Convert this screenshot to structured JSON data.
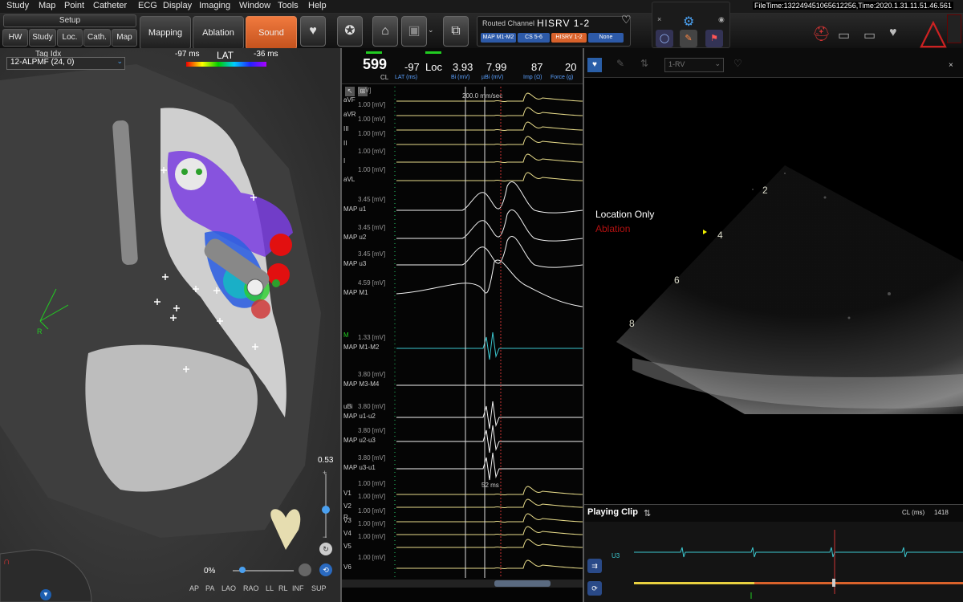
{
  "menu": [
    "Study",
    "Map",
    "Point",
    "Catheter",
    "ECG",
    "Display",
    "Imaging",
    "Window",
    "Tools",
    "Help"
  ],
  "status": {
    "file_time": "FileTime:132249451065612256,Time:2020.1.31.11.51.46.561"
  },
  "toolbar": {
    "setup_label": "Setup",
    "setup_buttons": [
      "HW",
      "Study",
      "Loc.",
      "Cath.",
      "Map"
    ],
    "mapping_label": "Mapping",
    "ablation_label": "Ablation",
    "sound_label": "Sound",
    "routed_channel_label": "Routed Channel",
    "routed_channel_value": "HISRV 1-2",
    "channel_buttons": [
      "MAP M1-M2",
      "CS 5-6",
      "HISRV 1-2",
      "None"
    ]
  },
  "left_panel": {
    "tag_label": "Tag Idx",
    "map_name": "12-ALPMF (24, 0)",
    "lat_min": "-97 ms",
    "lat_title": "LAT",
    "lat_max": "-36 ms",
    "zoom_value": "0.53",
    "pct_label": "0%",
    "axis_label": "R",
    "views": [
      "AP",
      "PA",
      "LAO",
      "RAO",
      "LL",
      "RL",
      "INF",
      "SUP"
    ]
  },
  "signal_panel": {
    "cl_value": "599",
    "cl_label": "CL",
    "lat_value": "-97",
    "lat_label": "LAT (ms)",
    "loc_label": "Loc",
    "bi_value": "3.93",
    "bi_label": "Bi (mV)",
    "ubi_value": "7.99",
    "ubi_label": "µBi (mV)",
    "imp_value": "87",
    "imp_label": "Imp (Ω)",
    "force_value": "20",
    "force_label": "Force (g)",
    "sweep_label": "200.0 mm/sec",
    "interval_label": "52 ms",
    "ubi_tag": "uBi",
    "m_tag": "M",
    "r_tag": "R",
    "traces": [
      {
        "name": "aVF",
        "mv": "[mV]"
      },
      {
        "name": "aVR",
        "mv": "1.00 [mV]"
      },
      {
        "name": "III",
        "mv": "1.00 [mV]"
      },
      {
        "name": "II",
        "mv": "1.00 [mV]"
      },
      {
        "name": "I",
        "mv": "1.00 [mV]"
      },
      {
        "name": "aVL",
        "mv": "1.00 [mV]"
      },
      {
        "name": "MAP u1",
        "mv": "3.45 [mV]"
      },
      {
        "name": "MAP u2",
        "mv": "3.45 [mV]"
      },
      {
        "name": "MAP u3",
        "mv": "3.45 [mV]"
      },
      {
        "name": "MAP M1",
        "mv": "4.59 [mV]"
      },
      {
        "name": "MAP M1-M2",
        "mv": "1.33 [mV]"
      },
      {
        "name": "MAP M3-M4",
        "mv": "3.80 [mV]"
      },
      {
        "name": "MAP u1-u2",
        "mv": "3.80 [mV]"
      },
      {
        "name": "MAP u2-u3",
        "mv": "3.80 [mV]"
      },
      {
        "name": "MAP u3-u1",
        "mv": "3.80 [mV]"
      },
      {
        "name": "V1",
        "mv": "1.00 [mV]"
      },
      {
        "name": "V2",
        "mv": "1.00 [mV]"
      },
      {
        "name": "V3",
        "mv": "1.00 [mV]"
      },
      {
        "name": "V4",
        "mv": "1.00 [mV]"
      },
      {
        "name": "V5",
        "mv": "1.00 [mV]"
      },
      {
        "name": "V6",
        "mv": "1.00 [mV]"
      }
    ]
  },
  "ultrasound": {
    "dropdown_value": "1-RV",
    "legend_location": "Location Only",
    "legend_ablation": "Ablation",
    "depth_marks": [
      "2",
      "4",
      "6",
      "8"
    ],
    "clip_label": "Playing Clip",
    "cl_label": "CL (ms)",
    "cl_value": "1418",
    "channel_label": "U3"
  },
  "colors": {
    "accent_orange": "#d9622b",
    "lat_gradient": "rainbow",
    "trace_cyan": "#3cc8d0",
    "trace_yellow": "#e8dc8a"
  }
}
